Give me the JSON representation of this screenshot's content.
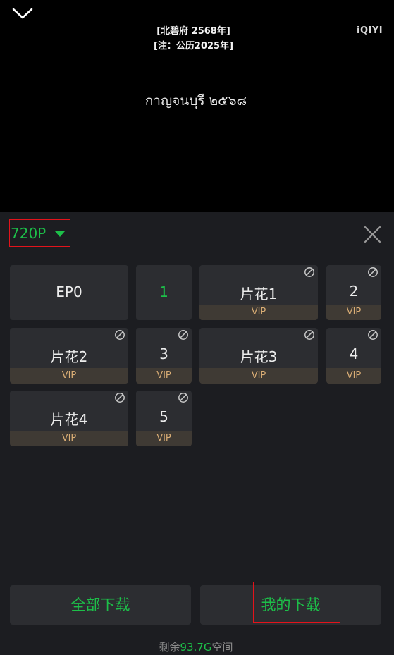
{
  "player": {
    "subtitle_cn_line1": "[北碧府 2568年]",
    "subtitle_cn_line2": "[注：公历2025年]",
    "subtitle_thai": "กาญจนบุรี ๒๕๖๘",
    "logo_text": "iQIYI",
    "collapse_icon": "chevron-down-icon"
  },
  "download_panel": {
    "quality": "720P",
    "quality_icon": "caret-down-icon",
    "close_icon": "close-icon",
    "vip_label": "VIP",
    "episodes": [
      {
        "label": "EP0",
        "vip": false,
        "active": false
      },
      {
        "label": "1",
        "vip": false,
        "active": true
      },
      {
        "label": "片花1",
        "vip": true,
        "active": false
      },
      {
        "label": "2",
        "vip": true,
        "active": false
      },
      {
        "label": "片花2",
        "vip": true,
        "active": false
      },
      {
        "label": "3",
        "vip": true,
        "active": false
      },
      {
        "label": "片花3",
        "vip": true,
        "active": false
      },
      {
        "label": "4",
        "vip": true,
        "active": false
      },
      {
        "label": "片花4",
        "vip": true,
        "active": false
      },
      {
        "label": "5",
        "vip": true,
        "active": false
      }
    ],
    "download_all_label": "全部下载",
    "my_downloads_label": "我的下载",
    "storage_prefix": "剩余",
    "storage_amount": "93.7G",
    "storage_suffix": "空间"
  },
  "colors": {
    "accent": "#1dbf49",
    "vip_text": "#d9ad75",
    "highlight_box": "#e3131b",
    "tile_bg": "#2c2d31",
    "panel_bg": "#1c1d21"
  }
}
